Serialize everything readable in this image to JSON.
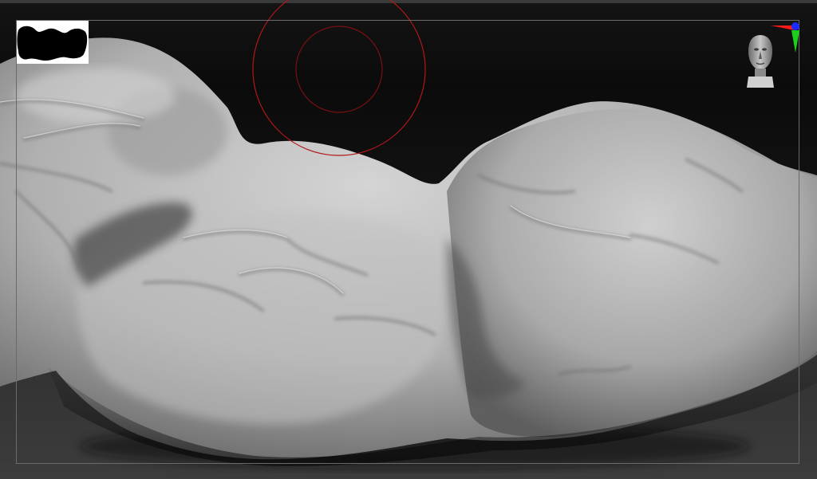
{
  "app": {
    "name": "",
    "mode": "sculpt-viewport"
  },
  "viewport": {
    "background_top": "#0b0b0b",
    "background_bottom": "#3c3c3c",
    "frame_color": "#6a6a6a",
    "model_color": "#b4b4b4"
  },
  "brush_cursor": {
    "color": "#b01818",
    "shape": "double-circle"
  },
  "alpha": {
    "icon": "brush-alpha-icon",
    "colors": [
      "#ffffff",
      "#000000"
    ]
  },
  "navigation": {
    "icon": "head-orientation-icon"
  },
  "axis_gizmo": {
    "icon": "axis-gizmo-icon",
    "x_color": "#ff1a1a",
    "y_color": "#19d219",
    "z_color": "#1a2cff"
  }
}
